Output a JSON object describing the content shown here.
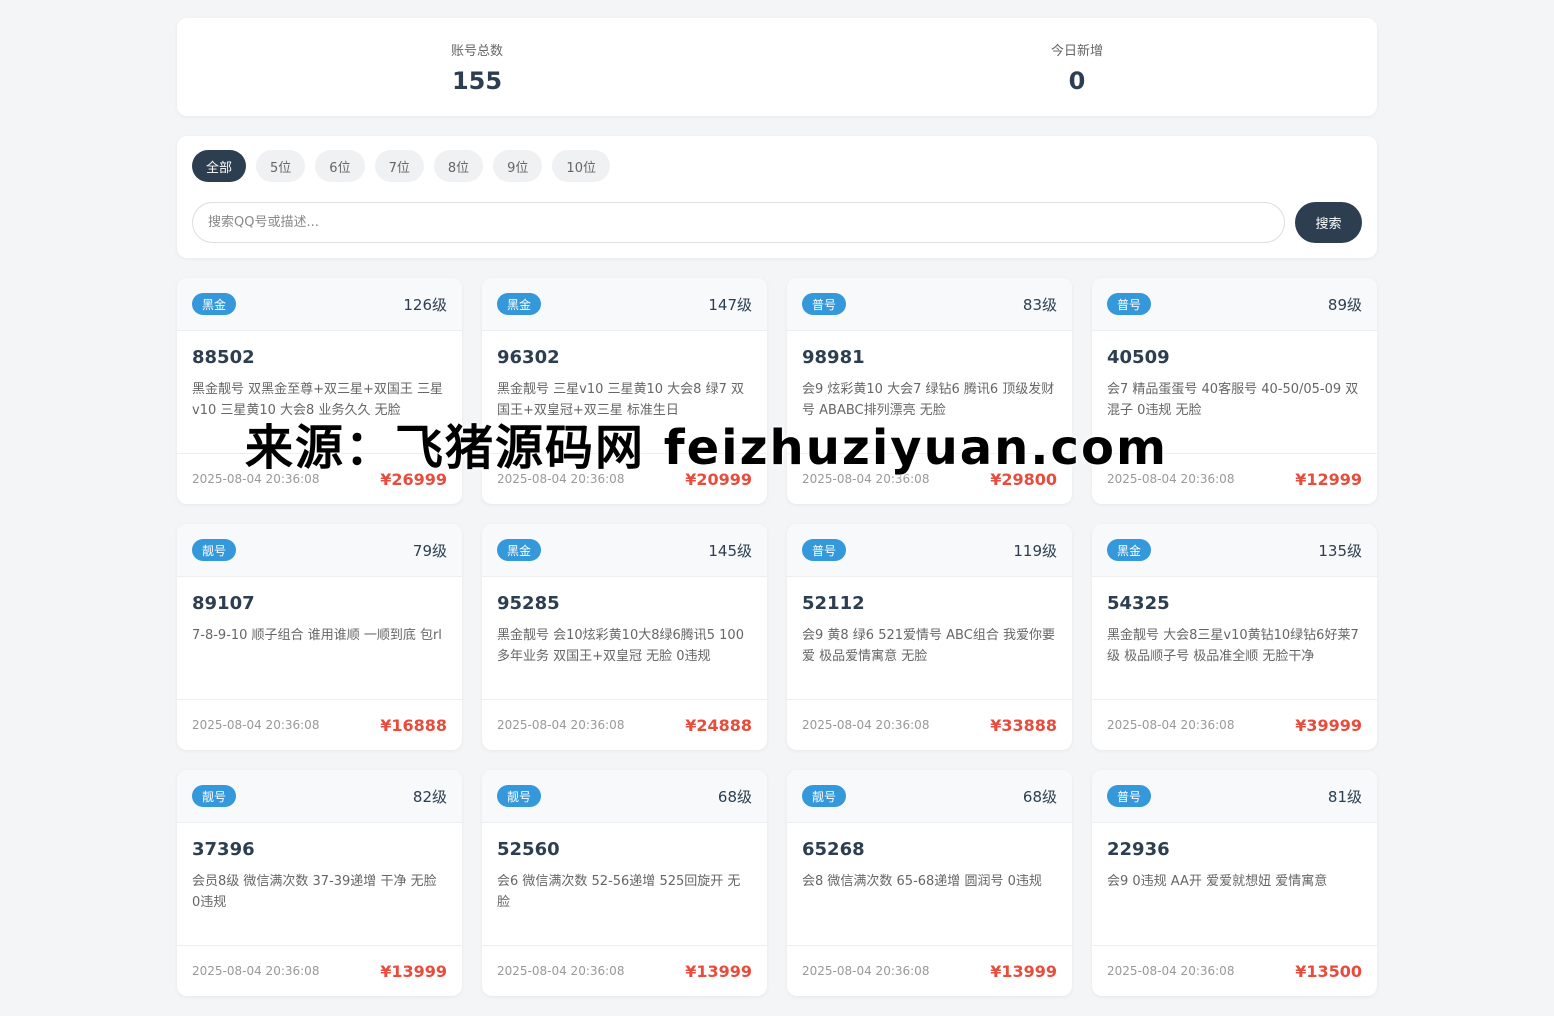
{
  "stats": {
    "total_label": "账号总数",
    "total_value": "155",
    "today_label": "今日新增",
    "today_value": "0"
  },
  "filter": {
    "tabs": [
      "全部",
      "5位",
      "6位",
      "7位",
      "8位",
      "9位",
      "10位"
    ],
    "active_tab": "全部",
    "search_placeholder": "搜索QQ号或描述...",
    "search_button": "搜索"
  },
  "cards": [
    {
      "badge": "黑金",
      "level": "126级",
      "qq": "88502",
      "desc": "黑金靓号 双黑金至尊+双三星+双国王 三星v10 三星黄10 大会8 业务久久 无脸",
      "time": "2025-08-04 20:36:08",
      "price": "¥26999"
    },
    {
      "badge": "黑金",
      "level": "147级",
      "qq": "96302",
      "desc": "黑金靓号 三星v10 三星黄10 大会8 绿7 双国王+双皇冠+双三星 标准生日",
      "time": "2025-08-04 20:36:08",
      "price": "¥20999"
    },
    {
      "badge": "普号",
      "level": "83级",
      "qq": "98981",
      "desc": "会9 炫彩黄10 大会7 绿钻6 腾讯6 顶级发财号 ABABC排列漂亮 无脸",
      "time": "2025-08-04 20:36:08",
      "price": "¥29800"
    },
    {
      "badge": "普号",
      "level": "89级",
      "qq": "40509",
      "desc": "会7 精品蛋蛋号 40客服号 40-50/05-09 双混子 0违规 无脸",
      "time": "2025-08-04 20:36:08",
      "price": "¥12999"
    },
    {
      "badge": "靓号",
      "level": "79级",
      "qq": "89107",
      "desc": "7-8-9-10 顺子组合 谁用谁顺 一顺到底 包rl",
      "time": "2025-08-04 20:36:08",
      "price": "¥16888"
    },
    {
      "badge": "黑金",
      "level": "145级",
      "qq": "95285",
      "desc": "黑金靓号 会10炫彩黄10大8绿6腾讯5 100多年业务 双国王+双皇冠 无脸 0违规",
      "time": "2025-08-04 20:36:08",
      "price": "¥24888"
    },
    {
      "badge": "普号",
      "level": "119级",
      "qq": "52112",
      "desc": "会9 黄8 绿6 521爱情号 ABC组合 我爱你要爱 极品爱情寓意 无脸",
      "time": "2025-08-04 20:36:08",
      "price": "¥33888"
    },
    {
      "badge": "黑金",
      "level": "135级",
      "qq": "54325",
      "desc": "黑金靓号 大会8三星v10黄钻10绿钻6好莱7级 极品顺子号 极品准全顺 无脸干净",
      "time": "2025-08-04 20:36:08",
      "price": "¥39999"
    },
    {
      "badge": "靓号",
      "level": "82级",
      "qq": "37396",
      "desc": "会员8级 微信满次数 37-39递增 干净 无脸 0违规",
      "time": "2025-08-04 20:36:08",
      "price": "¥13999"
    },
    {
      "badge": "靓号",
      "level": "68级",
      "qq": "52560",
      "desc": "会6 微信满次数 52-56递增 525回旋开 无脸",
      "time": "2025-08-04 20:36:08",
      "price": "¥13999"
    },
    {
      "badge": "靓号",
      "level": "68级",
      "qq": "65268",
      "desc": "会8 微信满次数 65-68递增 圆润号 0违规",
      "time": "2025-08-04 20:36:08",
      "price": "¥13999"
    },
    {
      "badge": "普号",
      "level": "81级",
      "qq": "22936",
      "desc": "会9 0违规 AA开 爱爱就想妞 爱情寓意",
      "time": "2025-08-04 20:36:08",
      "price": "¥13500"
    }
  ],
  "watermark": "来源：飞猪源码网 feizhuziyuan.com",
  "colors": {
    "primary": "#2c3e50",
    "badge": "#3498db",
    "price": "#e74c3c",
    "background": "#f4f5f7"
  }
}
